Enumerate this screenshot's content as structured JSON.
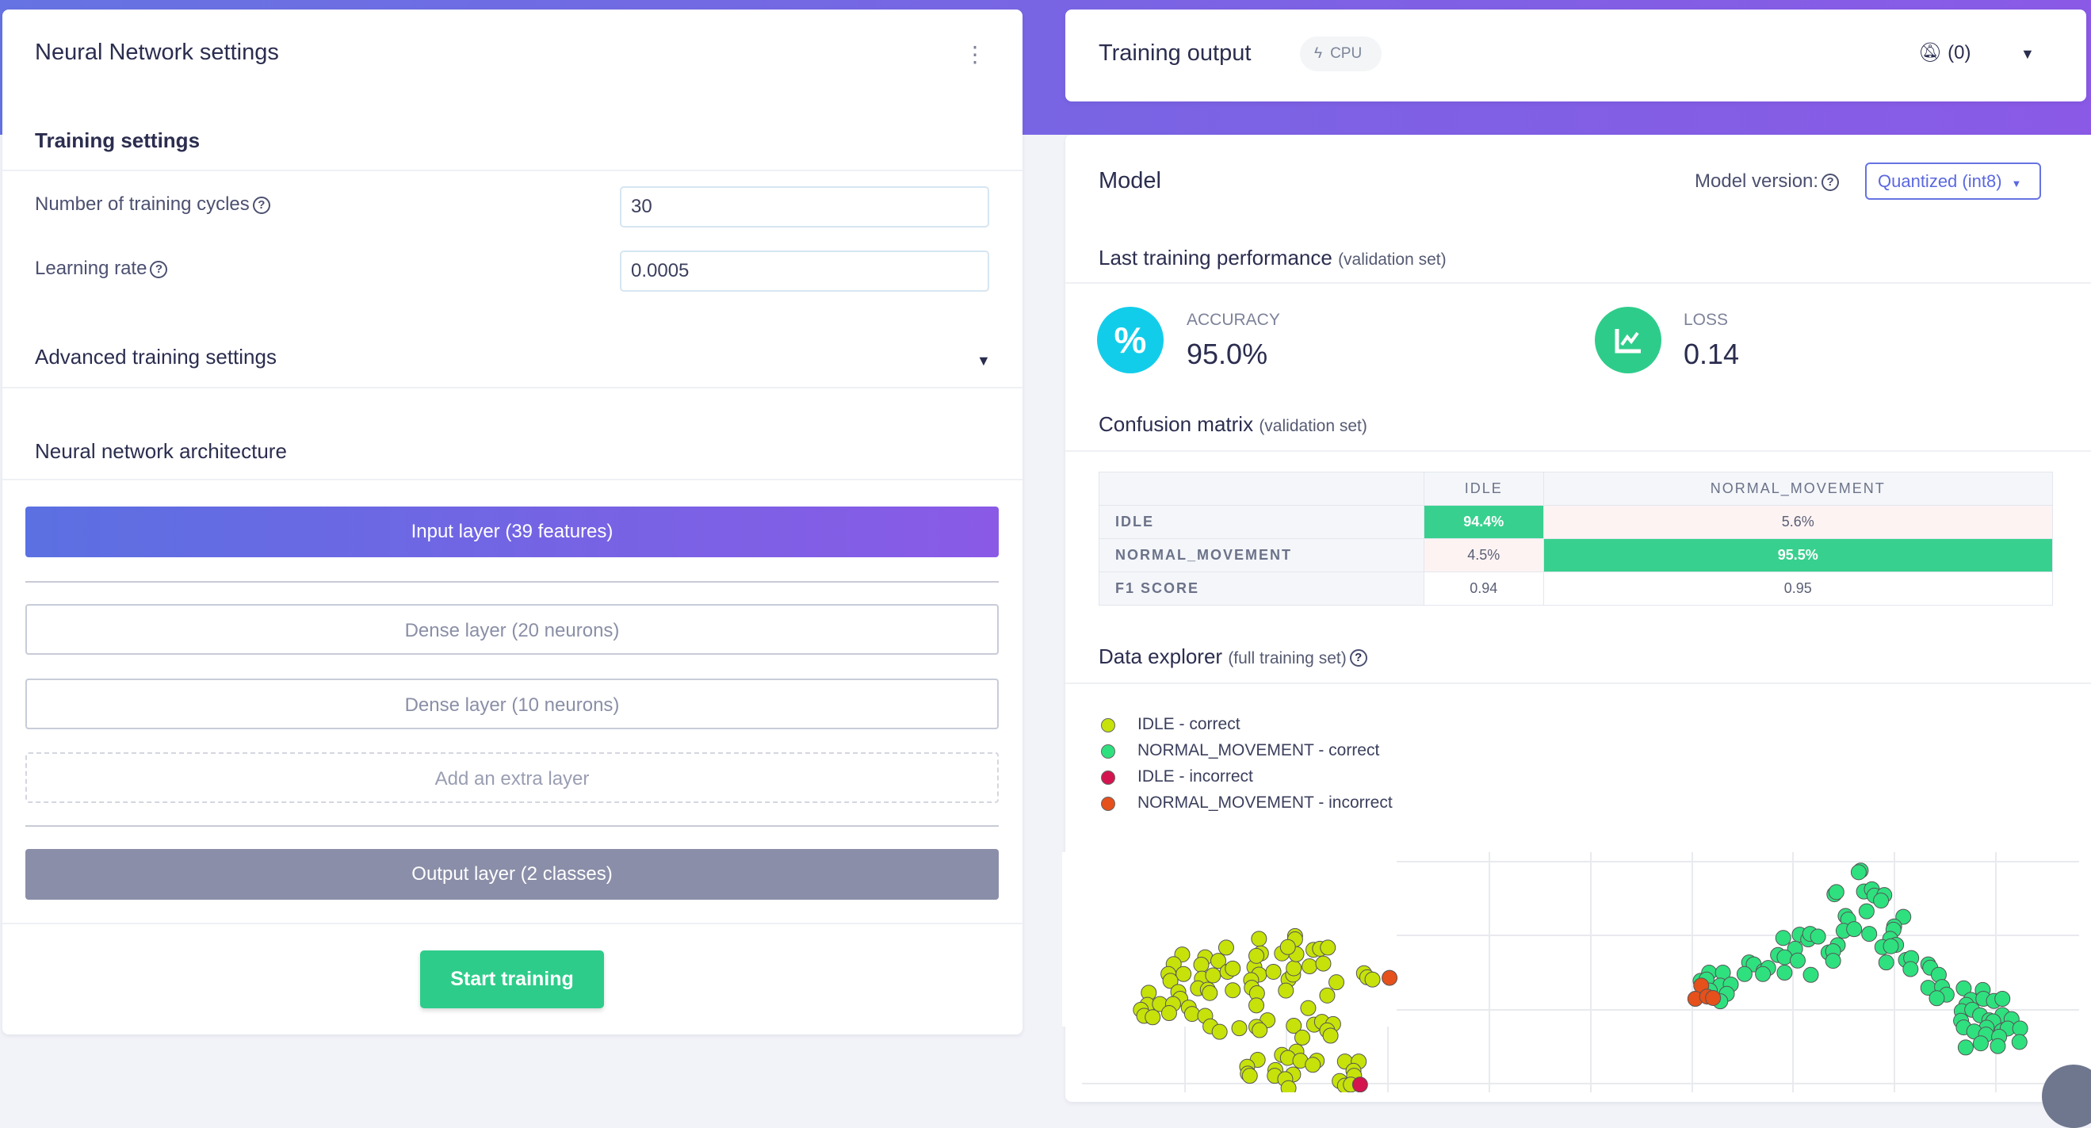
{
  "left_panel": {
    "title": "Neural Network settings",
    "training_settings": {
      "heading": "Training settings",
      "cycles_label": "Number of training cycles",
      "cycles_value": "30",
      "lr_label": "Learning rate",
      "lr_value": "0.0005"
    },
    "advanced_label": "Advanced training settings",
    "architecture": {
      "heading": "Neural network architecture",
      "input_layer": "Input layer (39 features)",
      "dense_layers": [
        "Dense layer (20 neurons)",
        "Dense layer (10 neurons)"
      ],
      "add_layer": "Add an extra layer",
      "output_layer": "Output layer (2 classes)"
    },
    "start_button": "Start training"
  },
  "output_card": {
    "title": "Training output",
    "badge": "CPU",
    "notifications": "(0)"
  },
  "model": {
    "title": "Model",
    "version_label": "Model version:",
    "version_selected": "Quantized (int8)",
    "performance": {
      "heading": "Last training performance",
      "qualifier": "(validation set)",
      "accuracy_label": "ACCURACY",
      "accuracy_value": "95.0%",
      "loss_label": "LOSS",
      "loss_value": "0.14"
    },
    "confusion": {
      "heading": "Confusion matrix",
      "qualifier": "(validation set)",
      "columns": [
        "IDLE",
        "NORMAL_MOVEMENT"
      ],
      "rows": [
        {
          "label": "IDLE",
          "values": [
            "94.4%",
            "5.6%"
          ]
        },
        {
          "label": "NORMAL_MOVEMENT",
          "values": [
            "4.5%",
            "95.5%"
          ]
        },
        {
          "label": "F1 SCORE",
          "values": [
            "0.94",
            "0.95"
          ]
        }
      ]
    },
    "explorer": {
      "heading": "Data explorer",
      "qualifier": "(full training set)"
    }
  },
  "colors": {
    "accent": "#6673e2",
    "green": "#2ecc8a",
    "cyan": "#12cdea"
  },
  "chart_data": {
    "type": "scatter",
    "xlim": [
      0,
      156.8
    ],
    "ylim": [
      0,
      87.3
    ],
    "grid": true,
    "legend": "top-left",
    "series": [
      {
        "name": "IDLE - correct",
        "color": "#c6e20a",
        "points": [
          [
            30,
            55.8
          ],
          [
            35.5,
            56.8
          ],
          [
            35.5,
            55.6
          ],
          [
            25,
            52.6
          ],
          [
            18.3,
            50.1
          ],
          [
            21.8,
            49.1
          ],
          [
            23.8,
            47.8
          ],
          [
            17,
            46.6
          ],
          [
            21.2,
            46.4
          ],
          [
            16.2,
            43
          ],
          [
            18.5,
            43
          ],
          [
            16.5,
            40.5
          ],
          [
            21.3,
            41.3
          ],
          [
            23,
            42.5
          ],
          [
            25.2,
            43.8
          ],
          [
            26,
            45
          ],
          [
            29.3,
            45.5
          ],
          [
            30,
            42.8
          ],
          [
            32.2,
            43.8
          ],
          [
            28.8,
            40.8
          ],
          [
            34.5,
            41
          ],
          [
            35.2,
            42.8
          ],
          [
            35.3,
            45.1
          ],
          [
            37.7,
            45.8
          ],
          [
            39.8,
            46.8
          ],
          [
            30.3,
            50.5
          ],
          [
            29.6,
            49.6
          ],
          [
            33.5,
            50.5
          ],
          [
            35.7,
            50.2
          ],
          [
            34.4,
            52.8
          ],
          [
            38.3,
            51.8
          ],
          [
            39.3,
            52.2
          ],
          [
            40.5,
            52.6
          ],
          [
            41.8,
            40
          ],
          [
            46,
            43.3
          ],
          [
            46.5,
            41.8
          ],
          [
            47.3,
            41
          ],
          [
            13.2,
            36.2
          ],
          [
            17.7,
            36.5
          ],
          [
            20.7,
            37.8
          ],
          [
            22.2,
            37.3
          ],
          [
            22.5,
            36.1
          ],
          [
            26,
            37.1
          ],
          [
            28.9,
            38
          ],
          [
            29.7,
            36
          ],
          [
            34.1,
            37
          ],
          [
            40.4,
            35.2
          ],
          [
            18,
            34
          ],
          [
            13,
            31.8
          ],
          [
            14.9,
            32.1
          ],
          [
            16.9,
            32.1
          ],
          [
            19.3,
            30.8
          ],
          [
            12,
            30
          ],
          [
            12.5,
            27.8
          ],
          [
            13.8,
            27.3
          ],
          [
            16.3,
            28.8
          ],
          [
            19.8,
            28.5
          ],
          [
            21.8,
            27.8
          ],
          [
            29.6,
            31.6
          ],
          [
            37.5,
            30.6
          ],
          [
            31.3,
            26.2
          ],
          [
            22.6,
            24
          ],
          [
            24,
            22
          ],
          [
            27,
            23.3
          ],
          [
            29.6,
            23.8
          ],
          [
            30.1,
            22.6
          ],
          [
            35.3,
            24.2
          ],
          [
            38.4,
            24.6
          ],
          [
            39.6,
            25.6
          ],
          [
            41.3,
            24.8
          ],
          [
            40.4,
            22.5
          ],
          [
            40.9,
            20.6
          ],
          [
            36.6,
            19.9
          ],
          [
            29.8,
            11.8
          ],
          [
            33.5,
            13.6
          ],
          [
            35.7,
            14.8
          ],
          [
            34.4,
            12.5
          ],
          [
            36.3,
            11.5
          ],
          [
            38.8,
            11.5
          ],
          [
            38.2,
            10
          ],
          [
            43.1,
            11.2
          ],
          [
            45.2,
            11.2
          ],
          [
            28.2,
            9.3
          ],
          [
            32.5,
            8.1
          ],
          [
            28.3,
            6.8
          ],
          [
            28.6,
            6
          ],
          [
            32.4,
            6
          ],
          [
            35.2,
            6.5
          ],
          [
            34,
            4.8
          ],
          [
            44.4,
            7.8
          ],
          [
            44.5,
            6
          ],
          [
            42.3,
            4.1
          ],
          [
            43.1,
            2.4
          ],
          [
            44,
            2.8
          ],
          [
            34.5,
            1.5
          ]
        ]
      },
      {
        "name": "NORMAL_MOVEMENT - correct",
        "color": "#2fe07f",
        "points": [
          [
            121.7,
            80.6
          ],
          [
            121.4,
            80
          ],
          [
            117.7,
            72
          ],
          [
            118,
            72.8
          ],
          [
            122.2,
            73
          ],
          [
            123.4,
            73.8
          ],
          [
            123.8,
            71.5
          ],
          [
            125.3,
            71.7
          ],
          [
            124.8,
            69.7
          ],
          [
            122.6,
            65.8
          ],
          [
            119.4,
            64.1
          ],
          [
            119.8,
            62.8
          ],
          [
            128.2,
            63.8
          ],
          [
            126.8,
            60.3
          ],
          [
            126.7,
            59.1
          ],
          [
            119.1,
            58.7
          ],
          [
            120.7,
            59.3
          ],
          [
            123,
            57.6
          ],
          [
            109.9,
            56.1
          ],
          [
            112.4,
            57.3
          ],
          [
            113.7,
            55.6
          ],
          [
            114,
            57.6
          ],
          [
            115.2,
            56.6
          ],
          [
            126.2,
            55.8
          ],
          [
            118.2,
            53.5
          ],
          [
            111.7,
            52.2
          ],
          [
            125,
            52.8
          ],
          [
            127.1,
            53.6
          ],
          [
            126.3,
            53.1
          ],
          [
            116.8,
            50.8
          ],
          [
            117.5,
            51.3
          ],
          [
            109.1,
            49.9
          ],
          [
            110.1,
            49.1
          ],
          [
            112.1,
            47.9
          ],
          [
            117.5,
            47.8
          ],
          [
            125.6,
            47.2
          ],
          [
            128.6,
            48.1
          ],
          [
            129.4,
            48.8
          ],
          [
            132,
            46.5
          ],
          [
            132.3,
            45.3
          ],
          [
            129.3,
            44.8
          ],
          [
            133.6,
            42.7
          ],
          [
            104.7,
            47.2
          ],
          [
            105.4,
            46.5
          ],
          [
            104,
            43
          ],
          [
            106.9,
            44.1
          ],
          [
            107.6,
            45.2
          ],
          [
            106.8,
            43
          ],
          [
            110.1,
            43.5
          ],
          [
            114.1,
            42.7
          ],
          [
            98.6,
            43.5
          ],
          [
            100.7,
            43.5
          ],
          [
            97.3,
            40.5
          ],
          [
            98.2,
            41
          ],
          [
            100.3,
            38.8
          ],
          [
            101.9,
            39.2
          ],
          [
            98.7,
            37
          ],
          [
            101.3,
            35.8
          ],
          [
            100.3,
            33.1
          ],
          [
            132,
            38
          ],
          [
            134.1,
            38.3
          ],
          [
            137.4,
            37.8
          ],
          [
            140.3,
            37.2
          ],
          [
            134.8,
            35.5
          ],
          [
            133.3,
            34.2
          ],
          [
            138.5,
            33.6
          ],
          [
            140.4,
            34
          ],
          [
            142,
            33.2
          ],
          [
            143.3,
            34
          ],
          [
            137.8,
            31.8
          ],
          [
            137.1,
            29.5
          ],
          [
            138.7,
            30
          ],
          [
            139.9,
            28
          ],
          [
            143.3,
            28.1
          ],
          [
            144.7,
            26.6
          ],
          [
            141.3,
            26.2
          ],
          [
            141.9,
            25.8
          ],
          [
            137,
            26
          ],
          [
            137.4,
            23.6
          ],
          [
            140.9,
            23.5
          ],
          [
            139,
            22.1
          ],
          [
            143.2,
            22.3
          ],
          [
            144.1,
            23.2
          ],
          [
            146,
            23.2
          ],
          [
            140.8,
            21
          ],
          [
            142.8,
            20.2
          ],
          [
            145.9,
            18.3
          ],
          [
            140,
            17.8
          ],
          [
            142.6,
            16.8
          ],
          [
            137.7,
            16.3
          ]
        ]
      },
      {
        "name": "IDLE - incorrect",
        "color": "#d3144f",
        "points": [
          [
            45.4,
            2.8
          ]
        ]
      },
      {
        "name": "NORMAL_MOVEMENT - incorrect",
        "color": "#e5501b",
        "points": [
          [
            49.9,
            41.6
          ],
          [
            97.4,
            38.8
          ],
          [
            96.5,
            34
          ],
          [
            98.3,
            34.8
          ],
          [
            99.2,
            34.3
          ]
        ]
      }
    ]
  }
}
